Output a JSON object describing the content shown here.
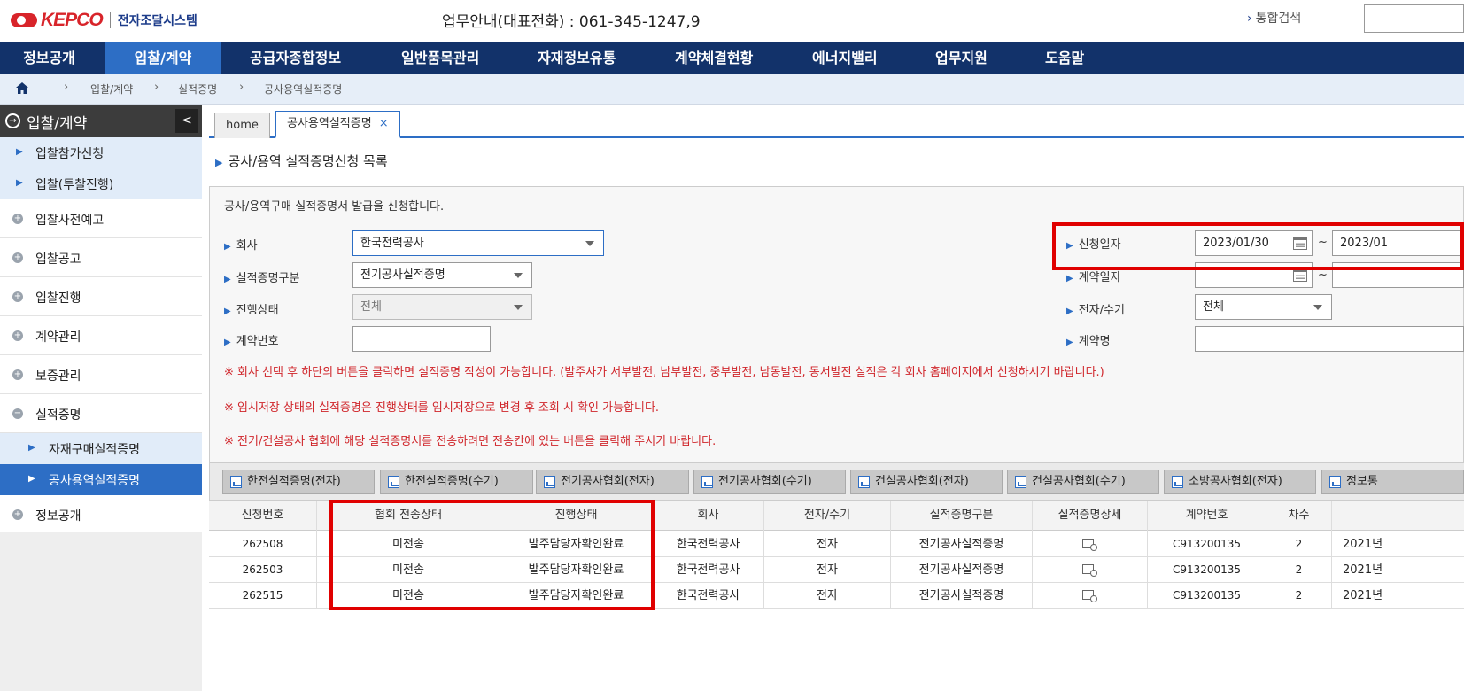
{
  "header": {
    "logo_text": "KEPCO",
    "system_name": "전자조달시스템",
    "contact": "업무안내(대표전화) : 061-345-1247,9",
    "unified_search": "통합검색"
  },
  "gnb": [
    {
      "label": "정보공개"
    },
    {
      "label": "입찰/계약",
      "active": true
    },
    {
      "label": "공급자종합정보"
    },
    {
      "label": "일반품목관리"
    },
    {
      "label": "자재정보유통"
    },
    {
      "label": "계약체결현황"
    },
    {
      "label": "에너지밸리"
    },
    {
      "label": "업무지원"
    },
    {
      "label": "도움말"
    }
  ],
  "breadcrumb": [
    "입찰/계약",
    "실적증명",
    "공사용역실적증명"
  ],
  "sidebar": {
    "title": "입찰/계약",
    "collapse": "<",
    "items": [
      {
        "label": "입찰참가신청",
        "type": "sub"
      },
      {
        "label": "입찰(투찰진행)",
        "type": "sub"
      },
      {
        "label": "입찰사전예고",
        "type": "item"
      },
      {
        "label": "입찰공고",
        "type": "item"
      },
      {
        "label": "입찰진행",
        "type": "item"
      },
      {
        "label": "계약관리",
        "type": "item"
      },
      {
        "label": "보증관리",
        "type": "item"
      },
      {
        "label": "실적증명",
        "type": "item",
        "expanded": true
      },
      {
        "label": "자재구매실적증명",
        "type": "sub2"
      },
      {
        "label": "공사용역실적증명",
        "type": "sub2",
        "active": true
      },
      {
        "label": "정보공개",
        "type": "item"
      }
    ]
  },
  "tabs": [
    {
      "label": "home"
    },
    {
      "label": "공사용역실적증명",
      "active": true,
      "close": "×"
    }
  ],
  "section_title": "공사/용역 실적증명신청 목록",
  "search": {
    "description": "공사/용역구매 실적증명서 발급을 신청합니다.",
    "company_label": "회사",
    "company_value": "한국전력공사",
    "cert_type_label": "실적증명구분",
    "cert_type_value": "전기공사실적증명",
    "status_label": "진행상태",
    "status_value": "전체",
    "contract_no_label": "계약번호",
    "contract_no_value": "",
    "apply_date_label": "신청일자",
    "apply_date_from": "2023/01/30",
    "apply_date_to": "2023/01",
    "contract_date_label": "계약일자",
    "contract_date_from": "",
    "contract_date_to": "",
    "elec_manual_label": "전자/수기",
    "elec_manual_value": "전체",
    "contract_name_label": "계약명",
    "contract_name_value": "",
    "tilde": "~",
    "notices": [
      "※ 회사 선택 후 하단의 버튼을 클릭하면 실적증명 작성이 가능합니다. (발주사가 서부발전, 남부발전, 중부발전, 남동발전, 동서발전 실적은 각 회사 홈페이지에서 신청하시기 바랍니다.)",
      "※ 임시저장 상태의 실적증명은 진행상태를 임시저장으로 변경 후 조회 시 확인 가능합니다.",
      "※ 전기/건설공사 협회에 해당 실적증명서를 전송하려면 전송칸에 있는 버튼을 클릭해 주시기 바랍니다."
    ]
  },
  "buttons": [
    "한전실적증명(전자)",
    "한전실적증명(수기)",
    "전기공사협회(전자)",
    "전기공사협회(수기)",
    "건설공사협회(전자)",
    "건설공사협회(수기)",
    "소방공사협회(전자)",
    "정보통"
  ],
  "table": {
    "columns": [
      "신청번호",
      "협회 전송상태",
      "진행상태",
      "회사",
      "전자/수기",
      "실적증명구분",
      "실적증명상세",
      "계약번호",
      "차수",
      ""
    ],
    "rows": [
      [
        "262508",
        "미전송",
        "발주담당자확인완료",
        "한국전력공사",
        "전자",
        "전기공사실적증명",
        "",
        "C913200135",
        "2",
        "2021년"
      ],
      [
        "262503",
        "미전송",
        "발주담당자확인완료",
        "한국전력공사",
        "전자",
        "전기공사실적증명",
        "",
        "C913200135",
        "2",
        "2021년"
      ],
      [
        "262515",
        "미전송",
        "발주담당자확인완료",
        "한국전력공사",
        "전자",
        "전기공사실적증명",
        "",
        "C913200135",
        "2",
        "2021년"
      ]
    ]
  },
  "colors": {
    "gnb_bg": "#12326a",
    "gnb_active": "#2d6ec5",
    "highlight": "#e00000",
    "notice": "#d0262b",
    "brand_red": "#d8242a"
  }
}
